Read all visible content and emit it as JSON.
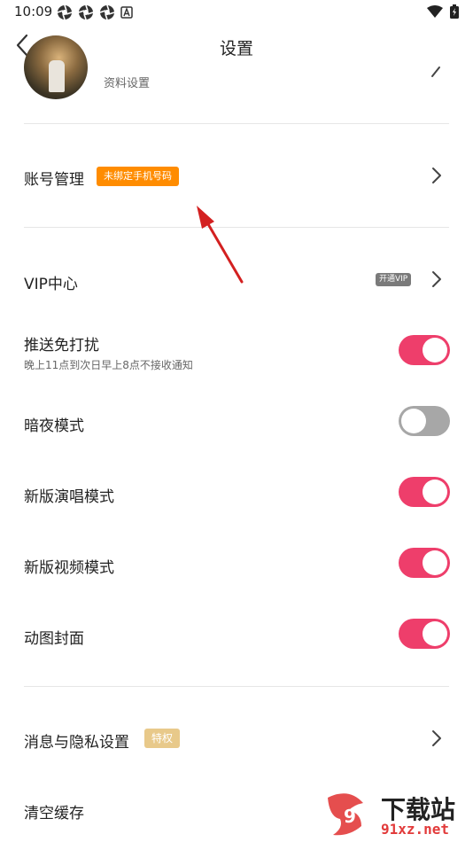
{
  "status_bar": {
    "time": "10:09"
  },
  "header": {
    "title": "设置"
  },
  "profile": {
    "subtitle": "资料设置"
  },
  "rows": {
    "account": {
      "label": "账号管理",
      "badge": "未绑定手机号码"
    },
    "vip": {
      "label": "VIP中心",
      "badge": "开通VIP"
    },
    "push": {
      "label": "推送免打扰",
      "sub": "晚上11点到次日早上8点不接收通知",
      "toggle": "on"
    },
    "dark": {
      "label": "暗夜模式",
      "toggle": "off"
    },
    "sing": {
      "label": "新版演唱模式",
      "toggle": "on"
    },
    "video": {
      "label": "新版视频模式",
      "toggle": "on"
    },
    "gif": {
      "label": "动图封面",
      "toggle": "on"
    },
    "privacy": {
      "label": "消息与隐私设置",
      "badge": "特权"
    },
    "cache": {
      "label": "清空缓存"
    }
  },
  "watermark": {
    "brand": "下载站",
    "url": "91xz.net"
  },
  "colors": {
    "toggle_on": "#ee3e6b",
    "toggle_off": "#a7a7a7",
    "badge_orange": "#ff8c00",
    "badge_priv": "#e8c98a",
    "annotation_arrow": "#d32020"
  }
}
